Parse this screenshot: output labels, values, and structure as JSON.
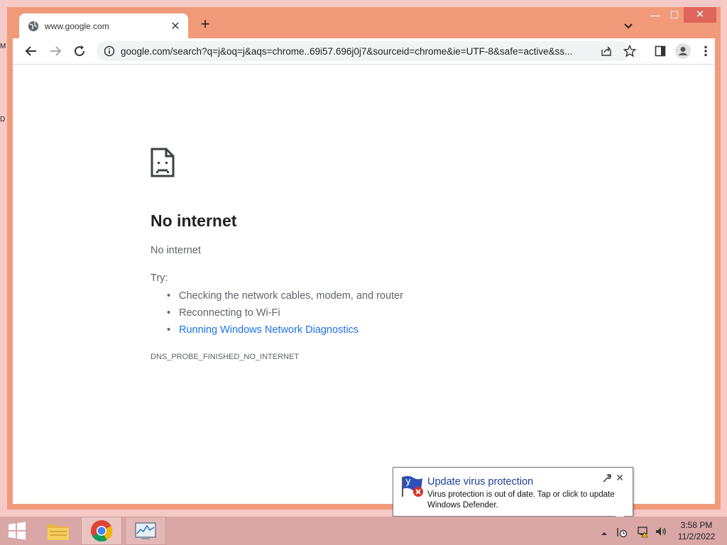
{
  "desktop": {
    "clipped_letters": [
      "M",
      "D"
    ]
  },
  "window": {
    "tab": {
      "title": "www.google.com",
      "favicon": "globe-icon"
    },
    "controls": {
      "minimize": "—",
      "maximize": "☐",
      "close": "✕",
      "new_tab": "+"
    }
  },
  "toolbar": {
    "url": "google.com/search?q=j&oq=j&aqs=chrome..69i57.696j0j7&sourceid=chrome&ie=UTF-8&safe=active&ss..."
  },
  "error_page": {
    "title": "No internet",
    "subtitle": "No internet",
    "try_label": "Try:",
    "suggestions": [
      "Checking the network cables, modem, and router",
      "Reconnecting to Wi-Fi",
      "Running Windows Network Diagnostics"
    ],
    "error_code": "DNS_PROBE_FINISHED_NO_INTERNET"
  },
  "notification": {
    "title": "Update virus protection",
    "text": "Virus protection is out of date. Tap or click to update Windows Defender.",
    "close": "✕"
  },
  "taskbar": {
    "time": "3:58 PM",
    "date": "11/2/2022"
  },
  "colors": {
    "titlebar": "#f09a7a",
    "close_button": "#e0655a",
    "link": "#1a73e8",
    "notification_title": "#1c3f94",
    "taskbar": "#d9a8a6"
  }
}
